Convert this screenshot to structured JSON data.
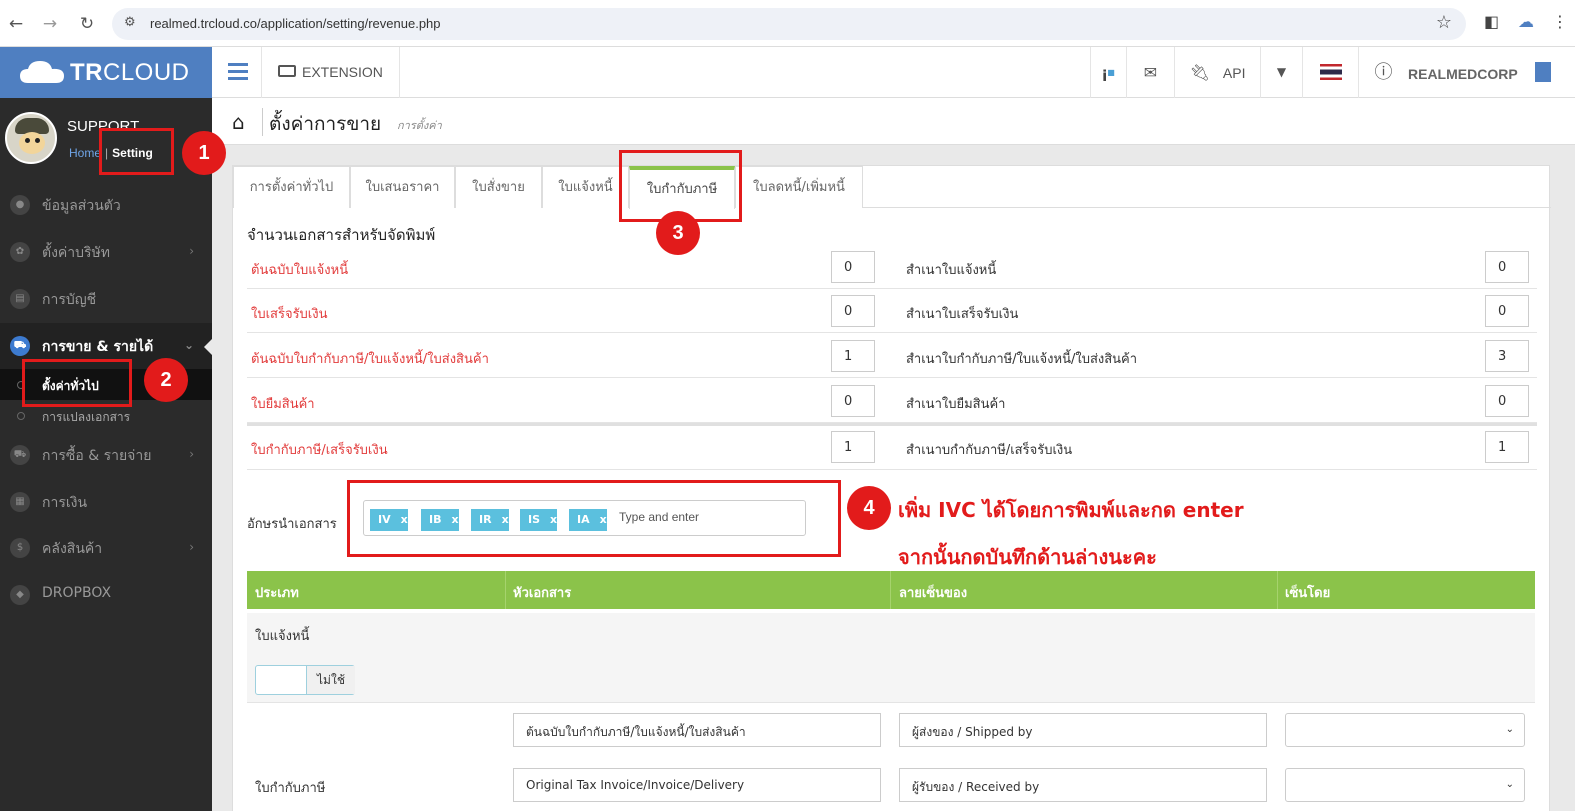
{
  "browser": {
    "url": "realmed.trcloud.co/application/setting/revenue.php"
  },
  "brand": {
    "logo_bold": "TR",
    "logo_rest": "CLOUD",
    "accent": "#4f7fc1"
  },
  "profile": {
    "name": "SUPPORT",
    "home_link": "Home",
    "setting_link": "Setting"
  },
  "sidebar": {
    "items": [
      {
        "label": "ข้อมูลส่วนตัว",
        "icon": "user-icon"
      },
      {
        "label": "ตั้งค่าบริษัท",
        "icon": "gear-icon"
      },
      {
        "label": "การบัญชี",
        "icon": "book-icon"
      },
      {
        "label": "การขาย & รายได้",
        "icon": "cart-icon"
      },
      {
        "label": "การซื้อ & รายจ่าย",
        "icon": "cart-icon"
      },
      {
        "label": "การเงิน",
        "icon": "calendar-icon"
      },
      {
        "label": "คลังสินค้า",
        "icon": "dollar-icon"
      },
      {
        "label": "DROPBOX",
        "icon": "dropbox-icon"
      }
    ],
    "sub_items": [
      {
        "label": "ตั้งค่าทั่วไป"
      },
      {
        "label": "การแปลงเอกสาร"
      }
    ]
  },
  "topbar": {
    "extension": "EXTENSION",
    "api": "API",
    "company": "REALMEDCORP"
  },
  "page": {
    "title": "ตั้งค่าการขาย",
    "subtitle": "การตั้งค่า"
  },
  "tabs": [
    {
      "label": "การตั้งค่าทั่วไป"
    },
    {
      "label": "ใบเสนอราคา"
    },
    {
      "label": "ใบสั่งขาย"
    },
    {
      "label": "ใบแจ้งหนี้"
    },
    {
      "label": "ใบกำกับภาษี"
    },
    {
      "label": "ใบลดหนี้/เพิ่มหนี้"
    }
  ],
  "print_section": {
    "title": "จำนวนเอกสารสำหรับจัดพิมพ์",
    "rows": [
      {
        "left_label": "ต้นฉบับใบแจ้งหนี้",
        "left_value": "0",
        "right_label": "สำเนาใบแจ้งหนี้",
        "right_value": "0"
      },
      {
        "left_label": "ใบเสร็จรับเงิน",
        "left_value": "0",
        "right_label": "สำเนาใบเสร็จรับเงิน",
        "right_value": "0"
      },
      {
        "left_label": "ต้นฉบับใบกำกับภาษี/ใบแจ้งหนี้/ใบส่งสินค้า",
        "left_value": "1",
        "right_label": "สำเนาใบกำกับภาษี/ใบแจ้งหนี้/ใบส่งสินค้า",
        "right_value": "3"
      },
      {
        "left_label": "ใบยืมสินค้า",
        "left_value": "0",
        "right_label": "สำเนาใบยืมสินค้า",
        "right_value": "0"
      },
      {
        "left_label": "ใบกำกับภาษี/เสร็จรับเงิน",
        "left_value": "1",
        "right_label": "สำเนาบกำกับภาษี/เสร็จรับเงิน",
        "right_value": "1"
      }
    ]
  },
  "prefix": {
    "label": "อักษรนำเอกสาร",
    "tags": [
      "IV",
      "IB",
      "IR",
      "IS",
      "IA"
    ],
    "tag_remove": "x",
    "placeholder": "Type and enter"
  },
  "annotations": {
    "badges": [
      "1",
      "2",
      "3",
      "4"
    ],
    "note_line1": "เพิ่ม IVC ได้โดยการพิมพ์และกด enter",
    "note_line2": "จากนั้นกดบันทึกด้านล่างนะคะ",
    "color": "#e21b1b"
  },
  "table": {
    "headers": [
      "ประเภท",
      "หัวเอกสาร",
      "ลายเซ็นของ",
      "เซ็นโดย"
    ],
    "invoice_label": "ใบแจ้งหนี้",
    "toggle_off": "ไม่ใช้",
    "tax_label": "ใบกำกับภาษี",
    "rows": [
      {
        "header": "ต้นฉบับใบกำกับภาษี/ใบแจ้งหนี้/ใบส่งสินค้า",
        "signature": "ผู้ส่งของ / Shipped by",
        "signer": ""
      },
      {
        "header": "Original Tax Invoice/Invoice/Delivery",
        "signature": "ผู้รับของ / Received by",
        "signer": ""
      }
    ]
  },
  "colors": {
    "tab_active": "#8bc34a",
    "required_label": "#e23b3b",
    "tag": "#5bc0de"
  }
}
